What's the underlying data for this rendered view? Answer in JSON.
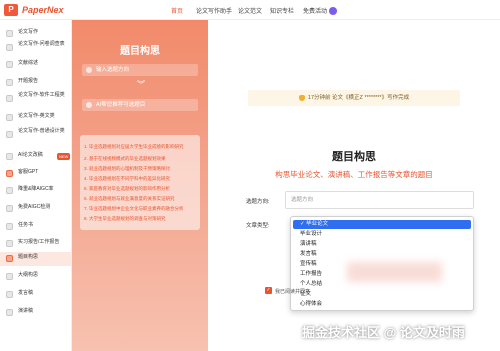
{
  "brand": {
    "logo_letter": "P",
    "name": "PaperNex"
  },
  "nav": [
    {
      "label": "首页"
    },
    {
      "label": "论文写作助手"
    },
    {
      "label": "论文范文"
    },
    {
      "label": "知识专栏"
    },
    {
      "label": "免费活动"
    }
  ],
  "sidebar": {
    "items": [
      {
        "label": "论文写作"
      },
      {
        "label": "论文写作-问卷调查表"
      },
      {
        "label": "文献综述"
      },
      {
        "label": "开题报告"
      },
      {
        "label": "论文写作-软件工程类"
      },
      {
        "label": "论文写作-英文类"
      },
      {
        "label": "论文写作-普通设计类"
      },
      {
        "label": "AI论文改稿",
        "badge": "NEW"
      },
      {
        "label": "客服GPT"
      },
      {
        "label": "降重&降AIGC率"
      },
      {
        "label": "免费AIGC检测"
      },
      {
        "label": "任务书"
      },
      {
        "label": "实习报告/工作报告"
      },
      {
        "label": "题目构思"
      },
      {
        "label": "大纲构思"
      },
      {
        "label": "发言稿"
      },
      {
        "label": "演讲稿"
      }
    ]
  },
  "panel": {
    "title": "题目构思",
    "step1": "输入选题方向",
    "step2": "AI帮您推荐可选题目",
    "ideas": [
      "1. 毕业选题规划对应届大学生毕业成绩的影响研究",
      "2. 基于在线视频模式的毕业选题规划效果",
      "3. 就业选题规划的心理机制及干预策略探讨",
      "4. 毕业选题规划在不同学科中的差异化研究",
      "5. 家庭教育对毕业选题规划的影响作用分析",
      "6. 就业选题规划与就业满意度的关系实证研究",
      "7. 毕业选题规划中企业文化与职业素养的融合分析",
      "8. 大学生毕业选题规划的调查与对策研究"
    ]
  },
  "main": {
    "notice": "17分钟前 论文《横正Z ********》写作完成",
    "title": "题目构思",
    "subtitle": "构思毕业论文、演讲稿、工作报告等文章的题目",
    "topic_label": "选题方向:",
    "topic_placeholder": "选题方向",
    "type_label": "文章类型:",
    "type_options": [
      "毕业论文",
      "毕业设计",
      "演讲稿",
      "发言稿",
      "宣传稿",
      "工作报告",
      "个人总结",
      "征文",
      "心得体会"
    ],
    "type_selected": "毕业论文",
    "checkbox_label": "我已阅读并同意"
  },
  "watermark": "掘金技术社区 @ 论文及时雨"
}
